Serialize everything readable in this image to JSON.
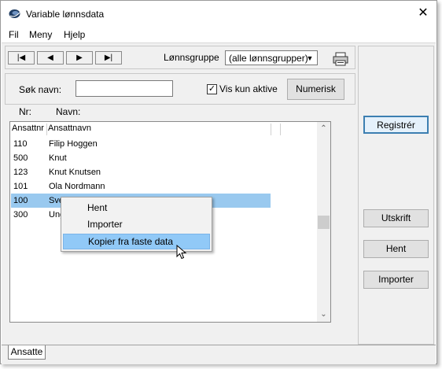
{
  "window": {
    "title": "Variable lønnsdata",
    "close_glyph": "✕"
  },
  "menu": [
    "Fil",
    "Meny",
    "Hjelp"
  ],
  "toolbar": {
    "nav_first": "|◀",
    "nav_prev": "◀",
    "nav_next": "▶",
    "nav_last": "▶|",
    "group_label": "Lønnsgruppe",
    "group_value": "(alle lønnsgrupper)",
    "dropdown_glyph": "▼",
    "print_icon": "printer-icon"
  },
  "filter": {
    "search_label": "Søk navn:",
    "search_value": "",
    "active_label": "Vis kun aktive",
    "active_checked": true,
    "check_glyph": "✓",
    "numeric_button": "Numerisk"
  },
  "list": {
    "nr_label": "Nr:",
    "name_label": "Navn:",
    "columns": [
      "Ansattnr",
      "Ansattnavn"
    ],
    "rows": [
      {
        "nr": "110",
        "name": "Filip Hoggen"
      },
      {
        "nr": "500",
        "name": "Knut"
      },
      {
        "nr": "123",
        "name": "Knut Knutsen"
      },
      {
        "nr": "101",
        "name": "Ola Nordmann"
      },
      {
        "nr": "100",
        "name": "Sve",
        "selected": true
      },
      {
        "nr": "300",
        "name": "Ung"
      }
    ],
    "scroll_up": "⌃",
    "scroll_down": "⌄"
  },
  "side_buttons": {
    "register": "Registrér",
    "print": "Utskrift",
    "fetch": "Hent",
    "import": "Importer"
  },
  "context_menu": {
    "items": [
      "Hent",
      "Importer",
      "Kopier fra faste data"
    ],
    "highlighted_index": 2
  },
  "tabs": [
    "Ansatte"
  ],
  "colors": {
    "selection": "#99c9ef",
    "highlight": "#91c9f7",
    "panel": "#f0f0f0"
  }
}
